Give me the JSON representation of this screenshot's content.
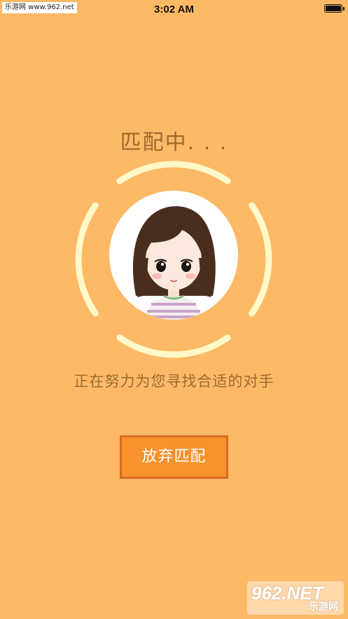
{
  "watermark_top": "乐游网 www.962.net",
  "status_bar": {
    "time": "3:02 AM",
    "battery_icon": "battery-icon"
  },
  "match": {
    "title": "匹配中. . .",
    "subtitle": "正在努力为您寻找合适的对手",
    "cancel_label": "放弃匹配"
  },
  "watermark_bottom": {
    "logo": "962.NET",
    "site": "乐游网"
  },
  "colors": {
    "background": "#FDB966",
    "ring": "#FFF8C8",
    "title_text": "#A06A2C",
    "button_fill": "#F7922D",
    "button_border": "#D96B22"
  }
}
